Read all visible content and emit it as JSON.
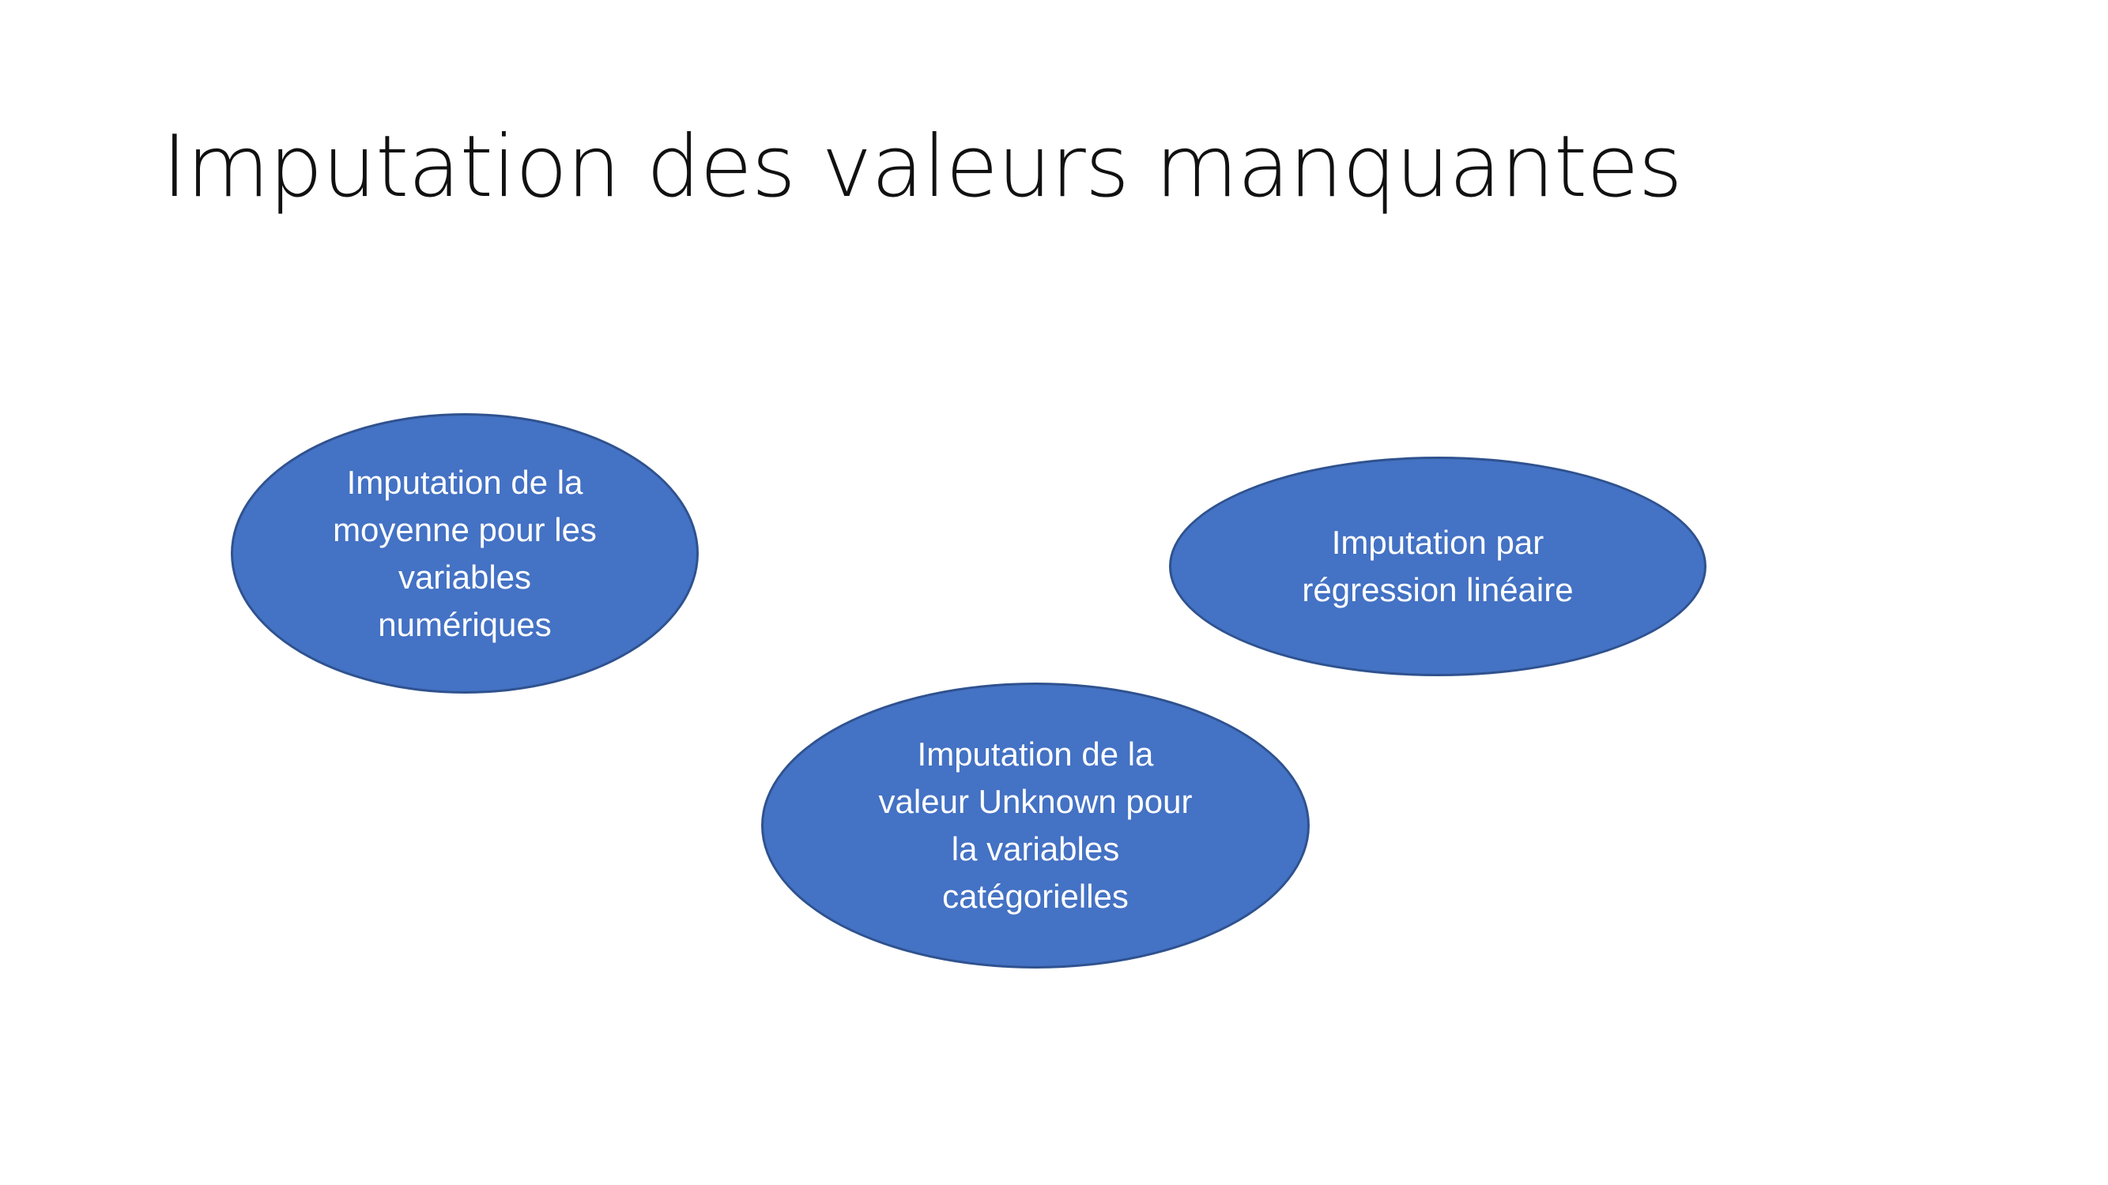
{
  "slide": {
    "title": "Imputation des valeurs manquantes"
  },
  "colors": {
    "ellipse_fill": "#4472c4",
    "ellipse_border": "#2f528f",
    "text_on_ellipse": "#ffffff",
    "title_text": "#111111"
  },
  "nodes": [
    {
      "lines": [
        "Imputation de la",
        "moyenne pour les",
        "variables",
        "numériques"
      ]
    },
    {
      "lines": [
        "Imputation par",
        "régression linéaire"
      ]
    },
    {
      "lines": [
        "Imputation de la",
        "valeur Unknown pour",
        "la variables",
        "catégorielles"
      ]
    }
  ]
}
